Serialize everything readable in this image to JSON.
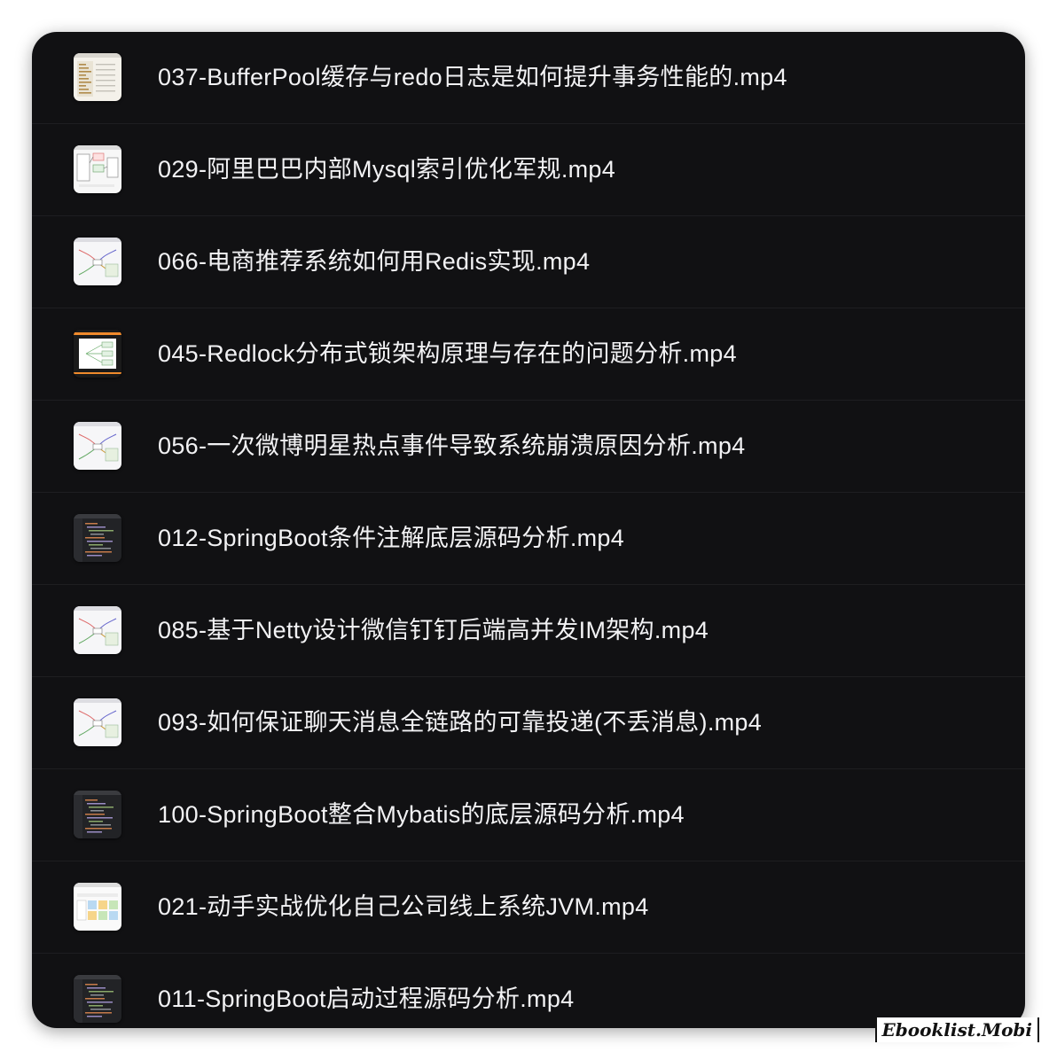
{
  "files": [
    {
      "name": "037-BufferPool缓存与redo日志是如何提升事务性能的.mp4",
      "thumb": "light-code"
    },
    {
      "name": "029-阿里巴巴内部Mysql索引优化军规.mp4",
      "thumb": "light-diagram"
    },
    {
      "name": "066-电商推荐系统如何用Redis实现.mp4",
      "thumb": "light-mindmap"
    },
    {
      "name": "045-Redlock分布式锁架构原理与存在的问题分析.mp4",
      "thumb": "dark-diagram"
    },
    {
      "name": "056-一次微博明星热点事件导致系统崩溃原因分析.mp4",
      "thumb": "light-mindmap"
    },
    {
      "name": "012-SpringBoot条件注解底层源码分析.mp4",
      "thumb": "dark-code"
    },
    {
      "name": "085-基于Netty设计微信钉钉后端高并发IM架构.mp4",
      "thumb": "light-mindmap"
    },
    {
      "name": "093-如何保证聊天消息全链路的可靠投递(不丢消息).mp4",
      "thumb": "light-mindmap"
    },
    {
      "name": "100-SpringBoot整合Mybatis的底层源码分析.mp4",
      "thumb": "dark-code"
    },
    {
      "name": "021-动手实战优化自己公司线上系统JVM.mp4",
      "thumb": "light-table"
    },
    {
      "name": "011-SpringBoot启动过程源码分析.mp4",
      "thumb": "dark-code"
    }
  ],
  "watermark": "Ebooklist.Mobi"
}
